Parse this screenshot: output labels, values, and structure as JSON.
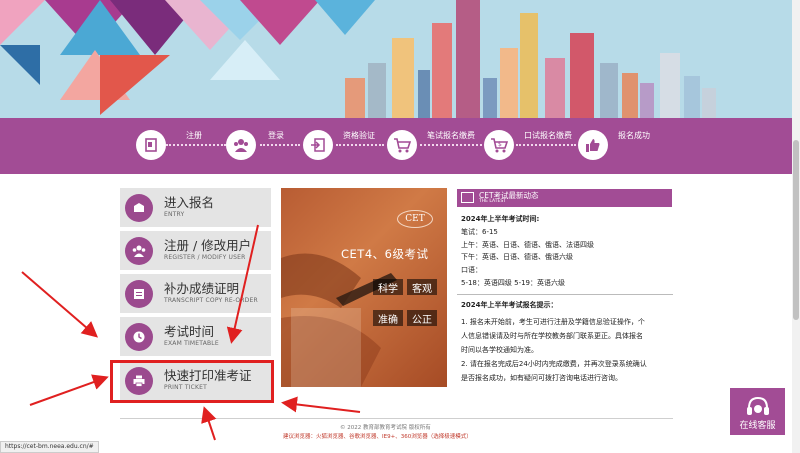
{
  "steps": [
    {
      "label": "注册",
      "icon": "register-form-icon"
    },
    {
      "label": "登录",
      "icon": "users-icon"
    },
    {
      "label": "资格验证",
      "icon": "login-verify-icon"
    },
    {
      "label": "笔试报名缴费",
      "icon": "shopping-cart-icon"
    },
    {
      "label": "口试报名缴费",
      "icon": "dollar-cart-icon"
    },
    {
      "label": "报名成功",
      "icon": "thumbs-up-icon"
    }
  ],
  "menu": [
    {
      "cn": "进入报名",
      "en": "ENTRY",
      "icon": "entry-icon"
    },
    {
      "cn": "注册 / 修改用户",
      "en": "REGISTER / MODIFY USER",
      "icon": "users-icon"
    },
    {
      "cn": "补办成绩证明",
      "en": "TRANSCRIPT COPY RE-ORDER",
      "icon": "certificate-icon"
    },
    {
      "cn": "考试时间",
      "en": "EXAM TIMETABLE",
      "icon": "clock-icon"
    },
    {
      "cn": "快速打印准考证",
      "en": "PRINT TICKET",
      "icon": "printer-icon"
    }
  ],
  "poster": {
    "logo": "CET",
    "title": "CET4、6级考试",
    "tags": [
      "科学",
      "客观",
      "准确",
      "公正"
    ]
  },
  "news": {
    "title": "CET考试最新动态",
    "subtitle": "THE LATEST",
    "lines": [
      {
        "text": "2024年上半年考试时间:",
        "bold": true
      },
      {
        "text": "笔试：6-15",
        "bold": false
      },
      {
        "text": "上午：英语、日语、德语、俄语、法语四级",
        "bold": false
      },
      {
        "text": "下午：英语、日语、德语、俄语六级",
        "bold": false
      },
      {
        "text": "口语：",
        "bold": false
      },
      {
        "text": "5-18：英语四级            5-19：英语六级",
        "bold": false
      }
    ],
    "tips_title": "2024年上半年考试报名提示：",
    "tips": [
      "1. 报名未开始前，考生可进行注册及学籍信息验证操作，个",
      "人信息错误请及时与所在学校教务部门联系更正。具体报名",
      "时间以各学校通知为准。",
      "2. 请在报名完成后24小时内完成缴费，并再次登录系统确认",
      "是否报名成功，如有疑问可拨打咨询电话进行咨询。"
    ]
  },
  "footer": {
    "copyright": "© 2022   教育部教育考试院   版权所有",
    "browsers": "建议浏览器：火狐浏览器、谷歌浏览器、IE9+、360浏览器（选择极速模式）"
  },
  "status_url": "https://cet-bm.neea.edu.cn/#",
  "online_service": "在线客服",
  "colors": {
    "brand": "#a24c95",
    "annotation": "#e02020",
    "sky": "#b7dbe8"
  }
}
